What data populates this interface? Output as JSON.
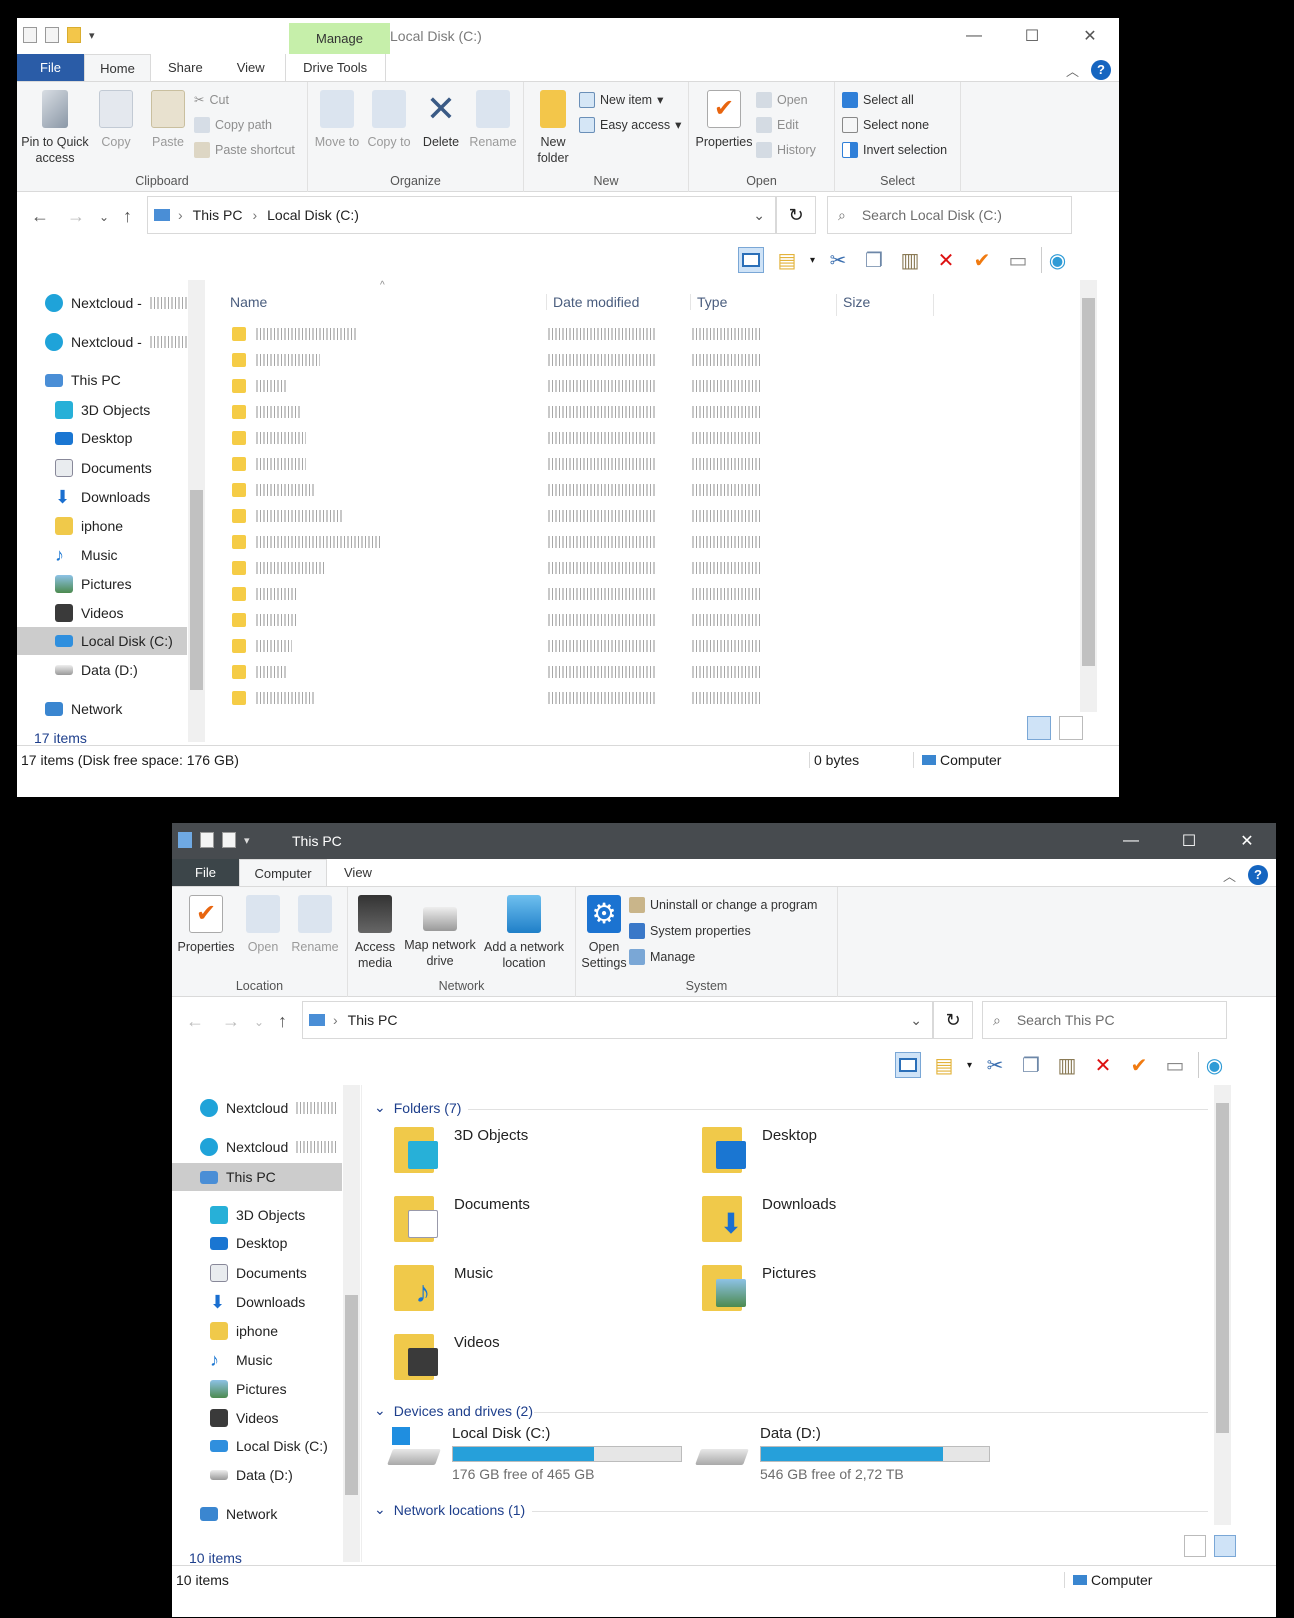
{
  "w1": {
    "title": "Local Disk (C:)",
    "manage": "Manage",
    "tabs": [
      "File",
      "Home",
      "Share",
      "View",
      "Drive Tools"
    ],
    "clipboard": {
      "pin": "Pin to Quick access",
      "copy": "Copy",
      "paste": "Paste",
      "cut": "Cut",
      "copy_path": "Copy path",
      "paste_shortcut": "Paste shortcut",
      "label": "Clipboard"
    },
    "organize": {
      "move": "Move to",
      "copy": "Copy to",
      "delete": "Delete",
      "rename": "Rename",
      "label": "Organize"
    },
    "new": {
      "new_folder": "New folder",
      "new_item": "New item",
      "easy_access": "Easy access",
      "label": "New"
    },
    "open": {
      "properties": "Properties",
      "open": "Open",
      "edit": "Edit",
      "history": "History",
      "label": "Open"
    },
    "select": {
      "all": "Select all",
      "none": "Select none",
      "invert": "Invert selection",
      "label": "Select"
    },
    "breadcrumb": [
      "This PC",
      "Local Disk (C:)"
    ],
    "search_placeholder": "Search Local Disk (C:)",
    "nav": [
      "Nextcloud -",
      "Nextcloud -",
      "This PC",
      "3D Objects",
      "Desktop",
      "Documents",
      "Downloads",
      "iphone",
      "Music",
      "Pictures",
      "Videos",
      "Local Disk (C:)",
      "Data (D:)",
      "Network"
    ],
    "columns": [
      "Name",
      "Date modified",
      "Type",
      "Size"
    ],
    "item_count": "17 items",
    "status_left": "17 items (Disk free space: 176 GB)",
    "status_size": "0 bytes",
    "status_loc": "Computer"
  },
  "w2": {
    "title": "This PC",
    "tabs": [
      "File",
      "Computer",
      "View"
    ],
    "location": {
      "properties": "Properties",
      "open": "Open",
      "rename": "Rename",
      "label": "Location"
    },
    "network": {
      "access_media": "Access media",
      "map_drive": "Map network drive",
      "add_location": "Add a network location",
      "label": "Network"
    },
    "system": {
      "open_settings": "Open Settings",
      "uninstall": "Uninstall or change a program",
      "sys_props": "System properties",
      "manage": "Manage",
      "label": "System"
    },
    "breadcrumb": [
      "This PC"
    ],
    "search_placeholder": "Search This PC",
    "nav": [
      "Nextcloud",
      "Nextcloud",
      "This PC",
      "3D Objects",
      "Desktop",
      "Documents",
      "Downloads",
      "iphone",
      "Music",
      "Pictures",
      "Videos",
      "Local Disk (C:)",
      "Data (D:)",
      "Network"
    ],
    "folders_header": "Folders (7)",
    "folders": [
      "3D Objects",
      "Desktop",
      "Documents",
      "Downloads",
      "Music",
      "Pictures",
      "Videos"
    ],
    "devices_header": "Devices and drives (2)",
    "drives": [
      {
        "name": "Local Disk (C:)",
        "free": "176 GB free of 465 GB",
        "used_fraction": 0.62
      },
      {
        "name": "Data (D:)",
        "free": "546 GB free of 2,72 TB",
        "used_fraction": 0.8
      }
    ],
    "netloc_header": "Network locations (1)",
    "item_count": "10 items",
    "status_left": "10 items",
    "status_loc": "Computer"
  }
}
